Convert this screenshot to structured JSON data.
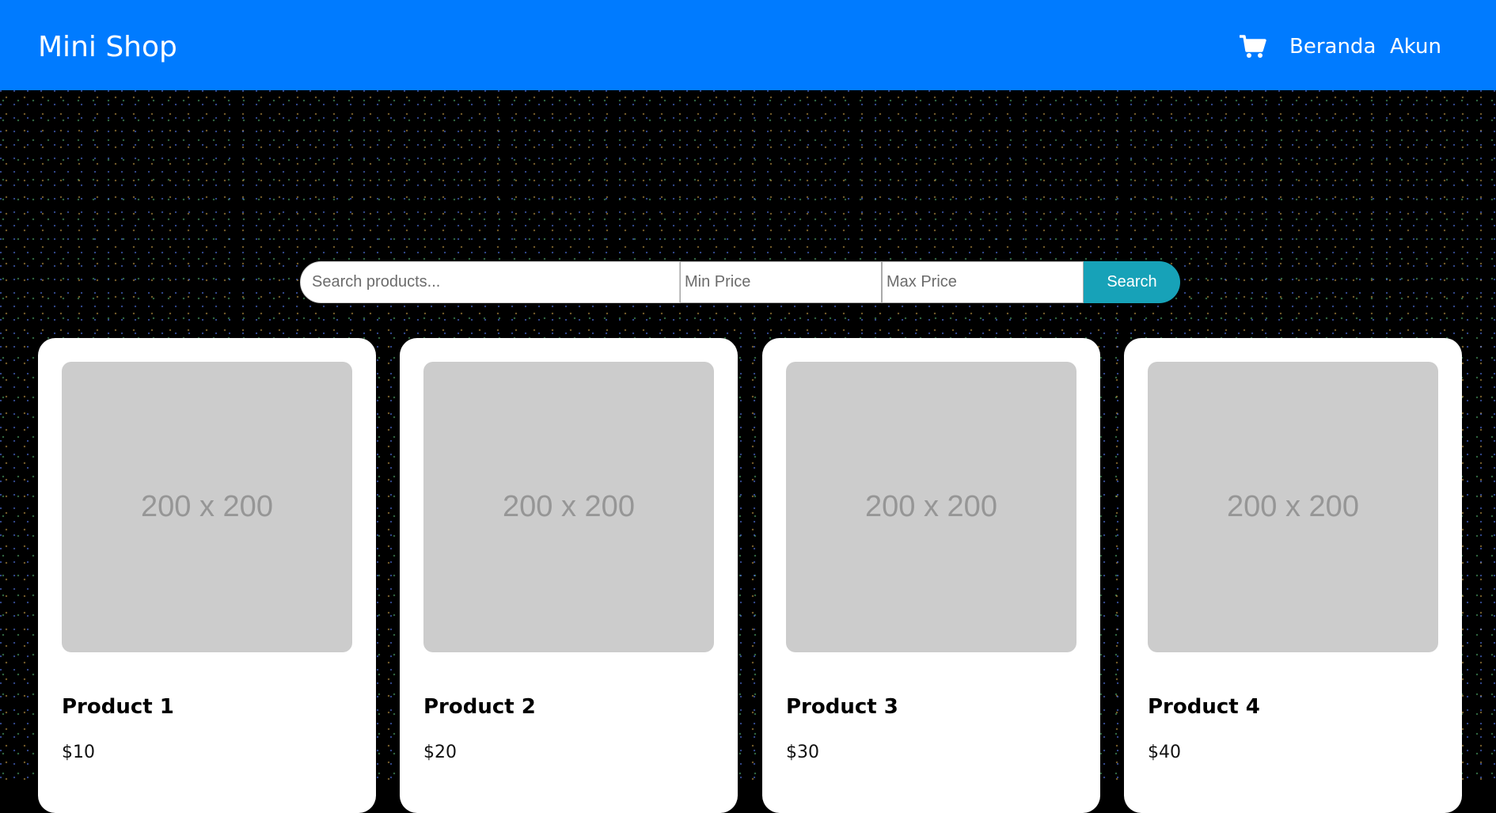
{
  "header": {
    "brand": "Mini Shop",
    "cart_icon": "shopping-cart-icon",
    "nav": [
      {
        "label": "Beranda"
      },
      {
        "label": "Akun"
      }
    ],
    "background_color": "#007bff"
  },
  "search": {
    "query_placeholder": "Search products...",
    "min_price_placeholder": "Min Price",
    "max_price_placeholder": "Max Price",
    "button_label": "Search",
    "button_color": "#17a2b8"
  },
  "products": [
    {
      "image_text": "200 x 200",
      "name": "Product 1",
      "price": "$10"
    },
    {
      "image_text": "200 x 200",
      "name": "Product 2",
      "price": "$20"
    },
    {
      "image_text": "200 x 200",
      "name": "Product 3",
      "price": "$30"
    },
    {
      "image_text": "200 x 200",
      "name": "Product 4",
      "price": "$40"
    }
  ]
}
